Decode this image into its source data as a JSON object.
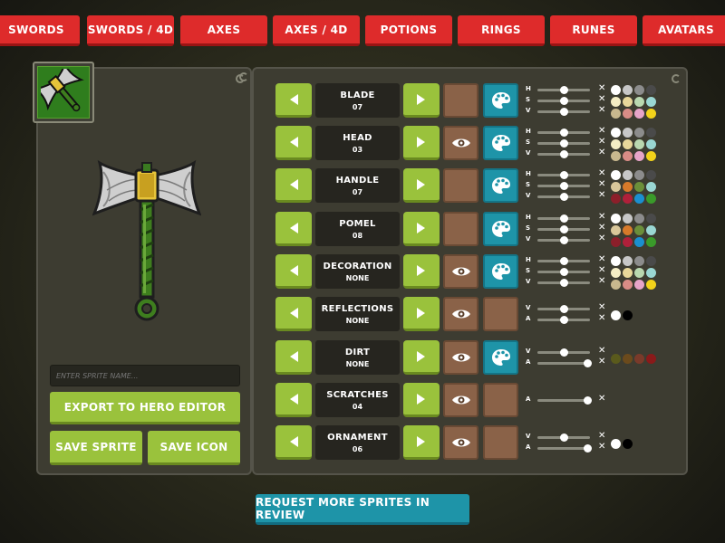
{
  "tabs": [
    "SWORDS",
    "SWORDS / 4D",
    "AXES",
    "AXES / 4D",
    "POTIONS",
    "RINGS",
    "RUNES",
    "AVATARS"
  ],
  "sidebar": {
    "name_placeholder": "ENTER SPRITE NAME...",
    "export_label": "EXPORT TO HERO EDITOR",
    "save_sprite_label": "SAVE SPRITE",
    "save_icon_label": "SAVE ICON"
  },
  "rows": [
    {
      "label": "BLADE",
      "value": "07",
      "eye": false,
      "palette": true,
      "sliders": [
        {
          "t": "H",
          "v": 0.5
        },
        {
          "t": "S",
          "v": 0.5
        },
        {
          "t": "V",
          "v": 0.5
        }
      ],
      "colors": [
        "#ffffff",
        "#c7c7c7",
        "#8c8c8c",
        "#4a4a4a",
        "#f4edc4",
        "#e8d79a",
        "#b9d8b0",
        "#9ad7d3",
        "#c8b88e",
        "#d98c86",
        "#e7a4c8",
        "#f2d21a"
      ]
    },
    {
      "label": "HEAD",
      "value": "03",
      "eye": true,
      "palette": true,
      "sliders": [
        {
          "t": "H",
          "v": 0.5
        },
        {
          "t": "S",
          "v": 0.5
        },
        {
          "t": "V",
          "v": 0.5
        }
      ],
      "colors": [
        "#ffffff",
        "#c7c7c7",
        "#8c8c8c",
        "#4a4a4a",
        "#f4edc4",
        "#e8d79a",
        "#b9d8b0",
        "#9ad7d3",
        "#c8b88e",
        "#d98c86",
        "#e7a4c8",
        "#f2d21a"
      ]
    },
    {
      "label": "HANDLE",
      "value": "07",
      "eye": false,
      "palette": true,
      "sliders": [
        {
          "t": "H",
          "v": 0.5
        },
        {
          "t": "S",
          "v": 0.5
        },
        {
          "t": "V",
          "v": 0.5
        }
      ],
      "colors": [
        "#ffffff",
        "#c7c7c7",
        "#8c8c8c",
        "#4a4a4a",
        "#d9c79a",
        "#d77a2a",
        "#6b8f3a",
        "#9ad7d3",
        "#8c1f2a",
        "#b0203a",
        "#1b8fd0",
        "#3a9a2a"
      ]
    },
    {
      "label": "POMEL",
      "value": "08",
      "eye": false,
      "palette": true,
      "sliders": [
        {
          "t": "H",
          "v": 0.5
        },
        {
          "t": "S",
          "v": 0.5
        },
        {
          "t": "V",
          "v": 0.5
        }
      ],
      "colors": [
        "#ffffff",
        "#c7c7c7",
        "#8c8c8c",
        "#4a4a4a",
        "#d9c79a",
        "#d77a2a",
        "#6b8f3a",
        "#9ad7d3",
        "#8c1f2a",
        "#b0203a",
        "#1b8fd0",
        "#3a9a2a"
      ]
    },
    {
      "label": "DECORATION",
      "value": "NONE",
      "eye": true,
      "palette": true,
      "sliders": [
        {
          "t": "H",
          "v": 0.5
        },
        {
          "t": "S",
          "v": 0.5
        },
        {
          "t": "V",
          "v": 0.5
        }
      ],
      "colors": [
        "#ffffff",
        "#c7c7c7",
        "#8c8c8c",
        "#4a4a4a",
        "#f4edc4",
        "#e8d79a",
        "#b9d8b0",
        "#9ad7d3",
        "#c8b88e",
        "#d98c86",
        "#e7a4c8",
        "#f2d21a"
      ]
    },
    {
      "label": "REFLECTIONS",
      "value": "NONE",
      "eye": true,
      "palette": false,
      "sliders": [
        {
          "t": "V",
          "v": 0.5
        },
        {
          "t": "A",
          "v": 0.5
        }
      ],
      "colors": [
        "#ffffff",
        "#000000"
      ]
    },
    {
      "label": "DIRT",
      "value": "NONE",
      "eye": true,
      "palette": true,
      "sliders": [
        {
          "t": "V",
          "v": 0.5
        },
        {
          "t": "A",
          "v": 0.95
        }
      ],
      "colors": [
        "#5a5a1c",
        "#6b4a1c",
        "#7a3a2a",
        "#8a1a1a"
      ]
    },
    {
      "label": "SCRATCHES",
      "value": "04",
      "eye": true,
      "palette": false,
      "sliders": [
        {
          "t": "A",
          "v": 0.95
        }
      ],
      "colors": []
    },
    {
      "label": "ORNAMENT",
      "value": "06",
      "eye": true,
      "palette": false,
      "sliders": [
        {
          "t": "V",
          "v": 0.5
        },
        {
          "t": "A",
          "v": 0.95
        }
      ],
      "colors": [
        "#ffffff",
        "#000000"
      ]
    }
  ],
  "bottom_button": "REQUEST MORE SPRITES IN REVIEW",
  "colors": {
    "tab_red": "#de2b2b",
    "green": "#9ac23c",
    "teal": "#1e94a8",
    "panel": "#3d3c31"
  }
}
